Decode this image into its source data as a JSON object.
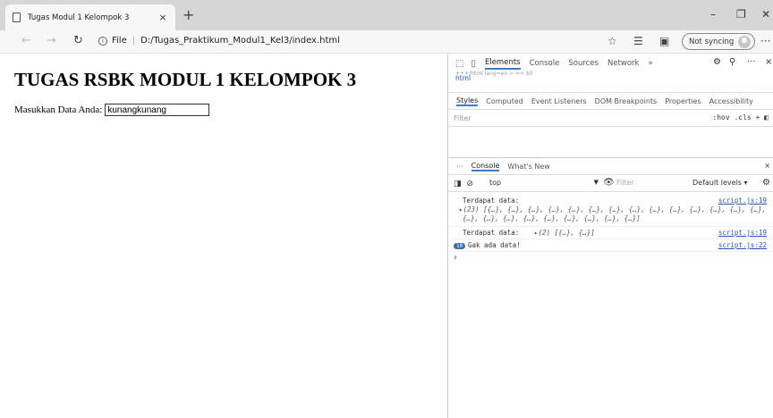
{
  "browser": {
    "tab_title": "Tugas Modul 1 Kelompok 3",
    "tab_close": "×",
    "new_tab": "+",
    "minimize": "–",
    "restore": "❐",
    "close": "✕",
    "address_label": "File",
    "address_separator": "|",
    "url": "D:/Tugas_Praktikum_Modul1_Kel3/index.html",
    "sync_label": "Not syncing",
    "more": "···"
  },
  "page": {
    "heading": "TUGAS RSBK MODUL 1 KELOMPOK 3",
    "input_label": "Masukkan Data Anda:",
    "input_value": "kunangkunang"
  },
  "devtools": {
    "tabs": [
      "Elements",
      "Console",
      "Sources",
      "Network"
    ],
    "more_tabs": "»",
    "breadcrumb_clipped": "+++/html lang=en > == $0",
    "breadcrumb": "html",
    "styles_tabs": [
      "Styles",
      "Computed",
      "Event Listeners",
      "DOM Breakpoints",
      "Properties",
      "Accessibility"
    ],
    "filter_placeholder": "Filter",
    "filter_tools": ":hov  .cls  +  ◧",
    "drawer_tabs": [
      "Console",
      "What's New"
    ],
    "drawer_menu": "···",
    "drawer_close": "×",
    "context": "top",
    "console_filter_placeholder": "Filter",
    "levels": "Default levels ▾",
    "logs": [
      {
        "label": "Terdapat data:",
        "line2": "▸(23) [{…}, {…}, {…}, {…}, {…}, {…}, {…}, {…}, {…}, {…}, {…}, {…}, {…}, {…},",
        "line3": "{…}, {…}, {…}, {…}, {…}, {…}, {…}, {…}, {…}]",
        "source": "script.js:19"
      },
      {
        "label": "Terdapat data:",
        "value": "▸(2) [{…}, {…}]",
        "source": "script.js:19"
      },
      {
        "badge": "10",
        "label": "Gak ada data!",
        "source": "script.js:22"
      }
    ],
    "prompt": "›"
  }
}
